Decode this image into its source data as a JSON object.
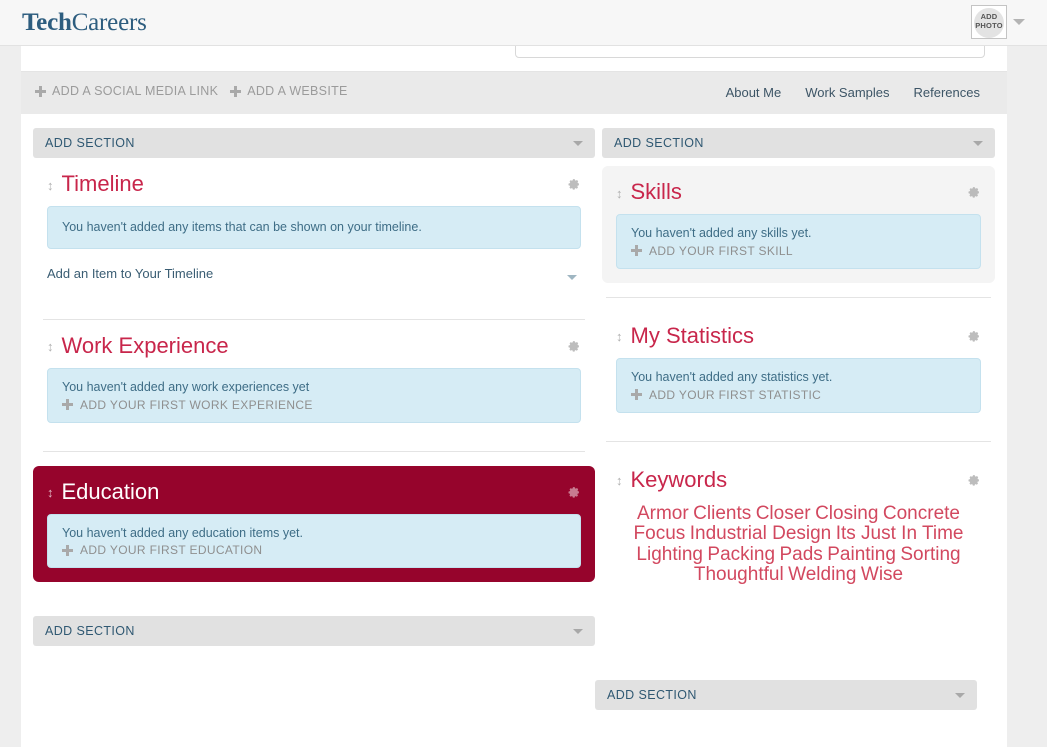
{
  "app": {
    "logo_bold": "Tech",
    "logo_regular": "Careers"
  },
  "header": {
    "add_photo_line1": "ADD",
    "add_photo_line2": "PHOTO",
    "photo_dropdown_icon": "chevron-down-icon"
  },
  "links_bar": {
    "add_social": "ADD A SOCIAL MEDIA LINK",
    "add_website": "ADD A WEBSITE",
    "nav": [
      {
        "label": "About Me"
      },
      {
        "label": "Work Samples"
      },
      {
        "label": "References"
      }
    ]
  },
  "add_section_label": "ADD SECTION",
  "left_column": {
    "top_add_section": "ADD SECTION",
    "bottom_add_section": "ADD SECTION",
    "timeline": {
      "title": "Timeline",
      "empty_message": "You haven't added any items that can be shown on your timeline.",
      "dropdown_label": "Add an Item to Your Timeline"
    },
    "work_experience": {
      "title": "Work Experience",
      "empty_message": "You haven't added any work experiences yet",
      "add_label": "ADD YOUR FIRST WORK EXPERIENCE"
    },
    "education": {
      "title": "Education",
      "empty_message": "You haven't added any education items yet.",
      "add_label": "ADD YOUR FIRST EDUCATION"
    }
  },
  "right_column": {
    "top_add_section": "ADD SECTION",
    "bottom_add_section": "ADD SECTION",
    "skills": {
      "title": "Skills",
      "empty_message": "You haven't added any skills yet.",
      "add_label": "ADD YOUR FIRST SKILL"
    },
    "statistics": {
      "title": "My Statistics",
      "empty_message": "You haven't added any statistics yet.",
      "add_label": "ADD YOUR FIRST STATISTIC"
    },
    "keywords": {
      "title": "Keywords",
      "tags": [
        "Armor",
        "Clients",
        "Closer",
        "Closing",
        "Concrete",
        "Focus",
        "Industrial Design",
        "Its Just In Time",
        "Lighting",
        "Packing",
        "Pads",
        "Painting",
        "Sorting",
        "Thoughtful",
        "Welding",
        "Wise"
      ]
    }
  },
  "colors": {
    "brand_blue": "#2d5d7f",
    "heading_red": "#c8264b",
    "selected_bg": "#96042c",
    "info_bg": "#d6ecf5",
    "info_text": "#3e6d86",
    "keyword": "#d2485f",
    "page_bg": "#eeeeee"
  },
  "icons": {
    "drag": "↕",
    "gear": "gear-icon",
    "plus": "plus-icon",
    "caret": "chevron-down-icon"
  }
}
